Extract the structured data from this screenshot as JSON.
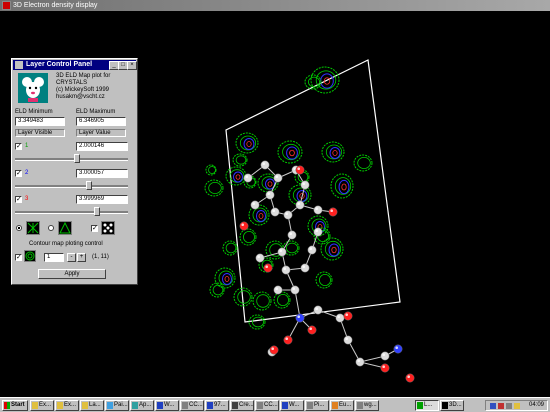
{
  "window": {
    "title": "3D Electron density display"
  },
  "panel": {
    "title": "Layer Control Panel",
    "title_buttons": [
      "_",
      "□",
      "×"
    ],
    "info_lines": [
      "3D ELD Map plot for",
      "CRYSTALS",
      "(c) MickeySoft 1999",
      "husakm@vscht.cz"
    ],
    "eld_min_label": "ELD Minimum",
    "eld_max_label": "ELD Maximum",
    "eld_min_value": "3.349483",
    "eld_max_value": "6.346905",
    "layer_visible_label": "Layer Visible",
    "layer_value_label": "Layer Value",
    "layers": [
      {
        "number": "1",
        "checked": true,
        "value": "2.000146",
        "color": "#00a000",
        "slider_fraction": 0.55
      },
      {
        "number": "2",
        "checked": true,
        "value": "3.000057",
        "color": "#0000ff",
        "slider_fraction": 0.66
      },
      {
        "number": "3",
        "checked": true,
        "value": "3.999969",
        "color": "#ff0000",
        "slider_fraction": 0.74
      }
    ],
    "contour_label": "Contour map ploting control",
    "contour_value": "1",
    "contour_range": "(1, 11)",
    "apply_label": "Apply"
  },
  "taskbar": {
    "start_label": "Start",
    "buttons": [
      {
        "label": "Ex...",
        "icon_color": "#e0c040"
      },
      {
        "label": "Ex...",
        "icon_color": "#e0c040"
      },
      {
        "label": "La...",
        "icon_color": "#e0c040"
      },
      {
        "label": "Pai...",
        "icon_color": "#40a0e0"
      },
      {
        "label": "Ap...",
        "icon_color": "#30a0a0"
      },
      {
        "label": "W...",
        "icon_color": "#2040c0"
      },
      {
        "label": "CC...",
        "icon_color": "#808080"
      },
      {
        "label": "97...",
        "icon_color": "#2040c0"
      },
      {
        "label": "Cre...",
        "icon_color": "#404040"
      },
      {
        "label": "CC...",
        "icon_color": "#808080"
      },
      {
        "label": "W...",
        "icon_color": "#2040c0"
      },
      {
        "label": "Pi...",
        "icon_color": "#808080"
      },
      {
        "label": "Eu...",
        "icon_color": "#e08020"
      },
      {
        "label": "wg...",
        "icon_color": "#808080"
      },
      {
        "label": "L...",
        "icon_color": "#00a000"
      },
      {
        "label": "3D...",
        "icon_color": "#000000"
      }
    ],
    "clock": "04:09"
  },
  "scene_colors": {
    "mesh": "#00cc00",
    "inner": "#3030ff",
    "core": "#ff3030",
    "atom_grey": "#dddddd",
    "atom_red": "#ff2020",
    "atom_blue": "#3040ff",
    "box": "#ffffff"
  }
}
